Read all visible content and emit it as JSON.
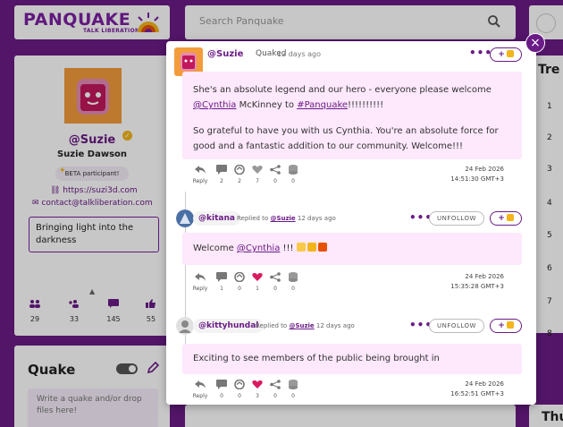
{
  "logo": {
    "name": "PANQUAKE",
    "tagline": "TALK LIBERATION"
  },
  "search": {
    "placeholder": "Search Panquake"
  },
  "profile": {
    "handle": "@Suzie",
    "name": "Suzie Dawson",
    "badge": "BETA participant!",
    "link": "https://suzi3d.com",
    "email": "contact@talkliberation.com",
    "bio": "Bringing light into the darkness",
    "stats": [
      "29",
      "33",
      "145",
      "55"
    ]
  },
  "quake_box": {
    "title": "Quake",
    "placeholder": "Write a quake and/or drop files here!"
  },
  "right_panel": {
    "title": "Tre",
    "numbers": [
      "1",
      "2",
      "3",
      "4",
      "5",
      "6",
      "7",
      "8"
    ],
    "bottom_title": "Thu"
  },
  "modal": {
    "close_label": "×",
    "main": {
      "handle": "@Suzie",
      "verb": "Quaked",
      "time": "12 days ago",
      "dots": "•••",
      "follow": "+",
      "para1_a": "She's an absolute legend and our hero - everyone please welcome ",
      "para1_link": "@Cynthia",
      "para1_b": " McKinney to ",
      "para1_tag": "#Panquake",
      "para1_c": "!!!!!!!!!!",
      "para2": "So grateful to have you with us Cynthia. You're an absolute force for good and a fantastic addition to our community. Welcome!!!",
      "actions": {
        "reply": "Reply",
        "comments": "2",
        "requakes": "2",
        "likes": "7",
        "shares": "0",
        "saves": "0"
      },
      "date": "24 Feb 2026",
      "time_stamp": "14:51:30 GMT+3"
    },
    "reply1": {
      "handle": "@kitana",
      "replied_text": "Replied to",
      "replied_to": "@Suzie",
      "time": "12 days ago",
      "dots": "•••",
      "unfollow": "UNFOLLOW",
      "follow": "+",
      "text_a": "Welcome ",
      "text_link": "@Cynthia",
      "text_b": " !!! ",
      "actions": {
        "reply": "Reply",
        "comments": "1",
        "requakes": "0",
        "likes": "1",
        "shares": "0",
        "saves": "0"
      },
      "date": "24 Feb 2026",
      "time_stamp": "15:35:28 GMT+3"
    },
    "reply2": {
      "handle": "@kittyhundal",
      "replied_text": "Replied to",
      "replied_to": "@Suzie",
      "time": "12 days ago",
      "dots": "•••",
      "unfollow": "UNFOLLOW",
      "follow": "+",
      "text": "Exciting to see members of the public being brought in",
      "actions": {
        "reply": "Reply",
        "comments": "0",
        "requakes": "0",
        "likes": "3",
        "shares": "0",
        "saves": "0"
      },
      "date": "24 Feb 2026",
      "time_stamp": "16:52:51 GMT+3"
    }
  },
  "colors": {
    "brand": "#6a1b86",
    "accent": "#f3b51b",
    "content_bg": "#fde8fc",
    "like": "#d81b60"
  }
}
